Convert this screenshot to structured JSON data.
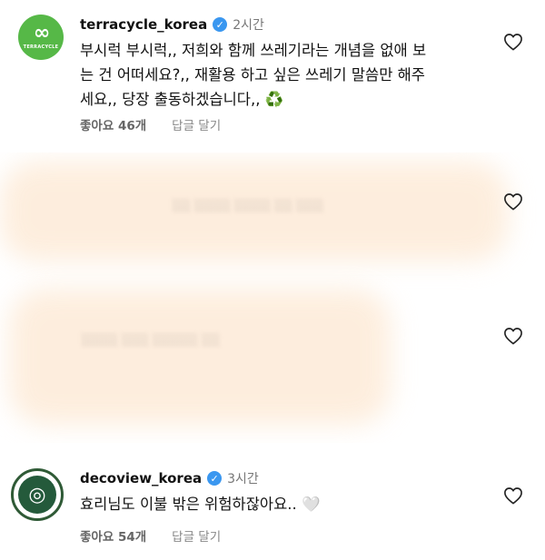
{
  "comments": [
    {
      "username": "terracycle_korea",
      "avatar_text": "TERRACYCLE",
      "time": "2시간",
      "text_lines": [
        "부시럭 부시럭,, 저희와 함께 쓰레기라는 개념을 없애 보",
        "는 건 어떠세요?,, 재활용 하고 싶은 쓰레기 말씀만 해주",
        "세요,, 당장 출동하겠습니다,, ♻️"
      ],
      "likes": "좋아요 46개",
      "reply": "답글 달기"
    },
    {
      "username": "decoview_korea",
      "time": "3시간",
      "text_lines": [
        "효리님도 이불 밖은 위험하잖아요.. 🤍"
      ],
      "likes": "좋아요 54개",
      "reply": "답글 달기"
    }
  ],
  "colors": {
    "terracycle_green": "#56b847",
    "verified_blue": "#3a97f0",
    "decoview_green": "#245a3b"
  },
  "icons": [
    "heart-outline-icon",
    "verified-badge-icon"
  ]
}
